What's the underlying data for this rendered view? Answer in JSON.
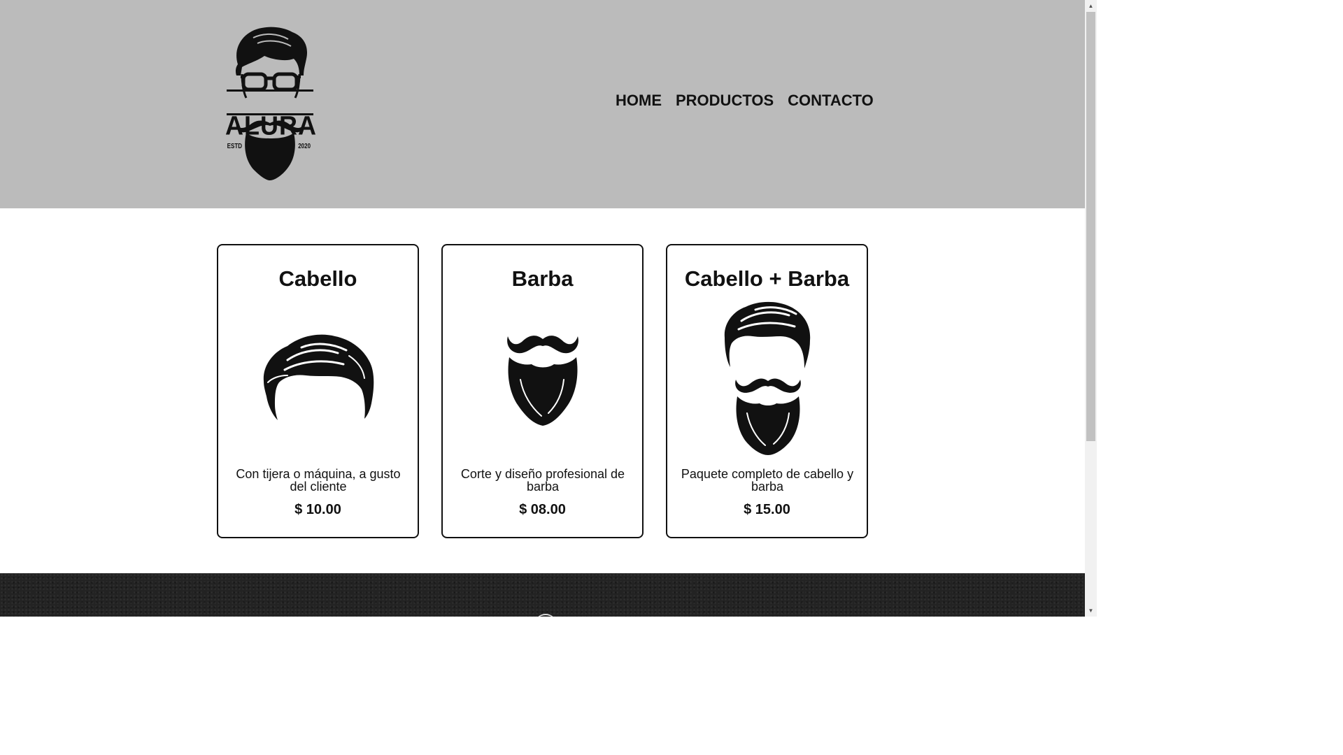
{
  "header": {
    "logo": {
      "brand": "ALURA",
      "estd": "ESTD",
      "year": "2020"
    },
    "nav": [
      {
        "label": "HOME"
      },
      {
        "label": "PRODUCTOS"
      },
      {
        "label": "CONTACTO"
      }
    ]
  },
  "products": [
    {
      "title": "Cabello",
      "description": "Con tijera o máquina, a gusto del cliente",
      "price": "$ 10.00",
      "icon": "hair-icon"
    },
    {
      "title": "Barba",
      "description": "Corte y diseño profesional de barba",
      "price": "$ 08.00",
      "icon": "beard-icon"
    },
    {
      "title": "Cabello + Barba",
      "description": "Paquete completo de cabello y barba",
      "price": "$ 15.00",
      "icon": "hair-and-beard-icon"
    }
  ],
  "colors": {
    "header_bg": "#bbbbbb",
    "footer_bg": "#232323",
    "text": "#111111"
  }
}
